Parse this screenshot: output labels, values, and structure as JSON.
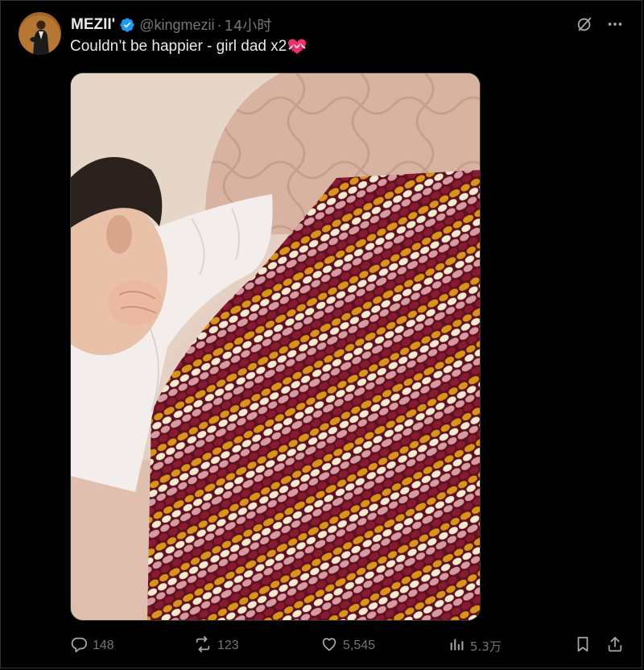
{
  "tweet": {
    "author": {
      "display_name": "MEZII'",
      "handle": "@kingmezii",
      "verified": true,
      "avatar_icon": "user-avatar"
    },
    "separator": "·",
    "timestamp": "14小时",
    "text": "Couldn’t be happier - girl dad x2",
    "emoji": "heart-with-ribbon-emoji",
    "media": {
      "type": "photo",
      "subject": "newborn baby under crochet blanket"
    },
    "top_actions": [
      {
        "name": "grok-icon"
      },
      {
        "name": "more-icon"
      }
    ],
    "stats": {
      "replies": "148",
      "reposts": "123",
      "likes": "5,545",
      "views": "5.3万"
    }
  },
  "colors": {
    "background": "#000000",
    "text_primary": "#e7e9ea",
    "text_secondary": "#71767b",
    "verified_blue": "#1d9bf0",
    "border": "#2f3336"
  }
}
